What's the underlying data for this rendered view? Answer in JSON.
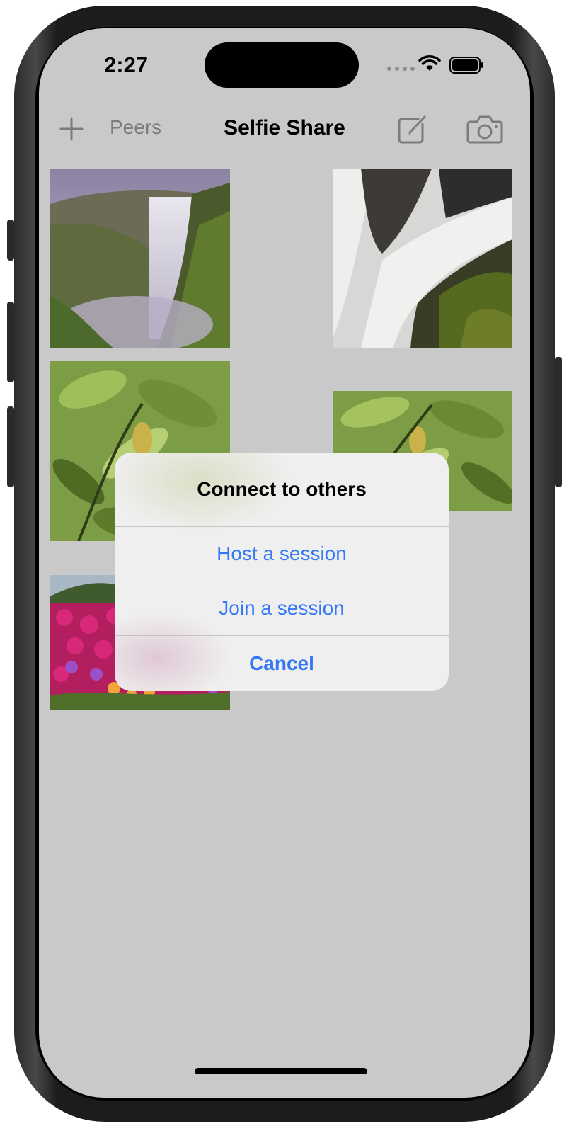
{
  "status_bar": {
    "time": "2:27",
    "signal_icon": "cellular-dots-icon",
    "wifi_icon": "wifi-icon",
    "battery_icon": "battery-icon",
    "battery_level": 1.0
  },
  "nav_bar": {
    "add_icon": "plus-icon",
    "peers_label": "Peers",
    "title": "Selfie Share",
    "compose_icon": "compose-icon",
    "camera_icon": "camera-icon"
  },
  "photos": [
    {
      "subject": "waterfall cliff"
    },
    {
      "subject": "waterfall rocks"
    },
    {
      "subject": "green leaves"
    },
    {
      "subject": "green leaves"
    },
    {
      "subject": "pink flowers"
    }
  ],
  "alert": {
    "title": "Connect to others",
    "actions": [
      {
        "label": "Host a session"
      },
      {
        "label": "Join a session"
      },
      {
        "label": "Cancel"
      }
    ]
  },
  "colors": {
    "accent": "#3478f6",
    "screen_background": "#c9c9c9"
  }
}
